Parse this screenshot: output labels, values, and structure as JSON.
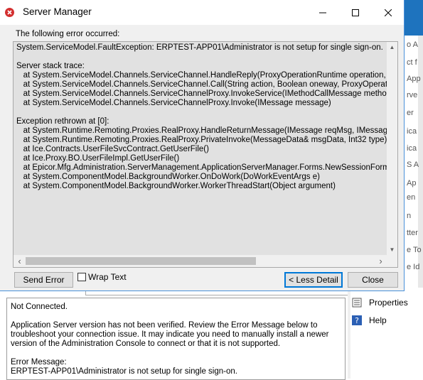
{
  "dialog": {
    "title": "Server Manager",
    "error_label": "The following error occurred:",
    "trace_lines": [
      "System.ServiceModel.FaultException: ERPTEST-APP01\\Administrator is not setup for single sign-on.",
      "",
      "Server stack trace:",
      "   at System.ServiceModel.Channels.ServiceChannel.HandleReply(ProxyOperationRuntime operation, ProxyRpc",
      "   at System.ServiceModel.Channels.ServiceChannel.Call(String action, Boolean oneway, ProxyOperationRuntim",
      "   at System.ServiceModel.Channels.ServiceChannelProxy.InvokeService(IMethodCallMessage methodCall, Pro",
      "   at System.ServiceModel.Channels.ServiceChannelProxy.Invoke(IMessage message)",
      "",
      "Exception rethrown at [0]:",
      "   at System.Runtime.Remoting.Proxies.RealProxy.HandleReturnMessage(IMessage reqMsg, IMessage retMsg)",
      "   at System.Runtime.Remoting.Proxies.RealProxy.PrivateInvoke(MessageData& msgData, Int32 type)",
      "   at Ice.Contracts.UserFileSvcContract.GetUserFile()",
      "   at Ice.Proxy.BO.UserFileImpl.GetUserFile()",
      "   at Epicor.Mfg.Administration.ServerManagement.ApplicationServerManager.Forms.NewSessionForm.Backgrou",
      "   at System.ComponentModel.BackgroundWorker.OnDoWork(DoWorkEventArgs e)",
      "   at System.ComponentModel.BackgroundWorker.WorkerThreadStart(Object argument)"
    ],
    "buttons": {
      "send_error": "Send Error",
      "wrap_text": "Wrap Text",
      "less_detail": "< Less Detail",
      "close": "Close"
    },
    "wrap_text_checked": false
  },
  "status_panel": {
    "line1": "Not Connected.",
    "para1": [
      "Application Server version has not been verified. Review the Error Message below to",
      "troubleshoot your connection issue. It may indicate you need to manually install a newer",
      "version of the Administration Console to connect or that it is not supported."
    ],
    "error_heading": "Error Message:",
    "error_text": "ERPTEST-APP01\\Administrator is not setup for single sign-on."
  },
  "side_panel": {
    "items": [
      {
        "label": "Properties",
        "icon": "properties-icon"
      },
      {
        "label": "Help",
        "icon": "help-icon"
      }
    ]
  },
  "background_fragments": [
    "o A",
    "ct f",
    "App",
    "rve",
    "er",
    "ica",
    "ica",
    "S A",
    "Ap",
    "en",
    "n",
    "tter",
    "e To",
    "e Id"
  ],
  "colors": {
    "accent": "#0078d7",
    "error_icon": "#d32f2f",
    "dialog_bg": "#f0f0f0",
    "trace_bg": "#e1e1e1"
  }
}
